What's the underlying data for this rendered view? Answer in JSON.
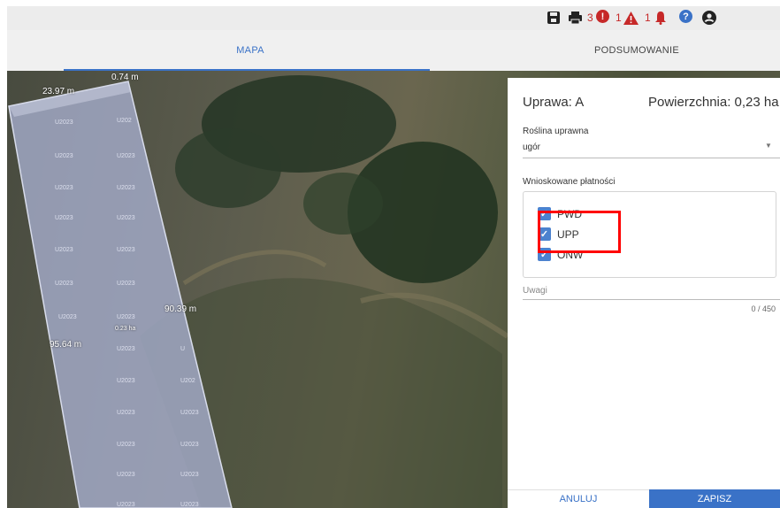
{
  "toolbar": {
    "icons": [
      "save-icon",
      "print-icon",
      "error-icon",
      "warning-icon",
      "bell-icon",
      "help-icon",
      "account-icon"
    ],
    "error_count": "3",
    "warning_count": "1",
    "notification_count": "1",
    "colors": {
      "error": "#c62828",
      "help": "#3a72c7",
      "icon": "#222222"
    }
  },
  "tabs": [
    {
      "label": "MAPA",
      "active": true
    },
    {
      "label": "PODSUMOWANIE",
      "active": false
    }
  ],
  "map": {
    "labels": [
      "0.74 m",
      "23.97 m",
      "90.39 m",
      "95.64 m",
      "0.23 ha"
    ],
    "plot_code": "U2023",
    "plot_code_partial": "U",
    "plot_code_clipped": "U202",
    "plot_color": "#a8b0cf"
  },
  "panel": {
    "crop_title": "Uprawa: A",
    "area_title": "Powierzchnia: 0,23 ha",
    "crop_label": "Roślina uprawna",
    "crop_value": "ugór",
    "payments_label": "Wnioskowane płatności",
    "payments": [
      {
        "code": "PWD",
        "checked": true
      },
      {
        "code": "UPP",
        "checked": true
      },
      {
        "code": "ONW",
        "checked": true
      }
    ],
    "notes_label": "Uwagi",
    "notes_counter": "0 / 450",
    "highlight_color": "#ff0000"
  },
  "footer": {
    "cancel_label": "ANULUJ",
    "save_label": "ZAPISZ",
    "accent": "#3a72c7"
  }
}
